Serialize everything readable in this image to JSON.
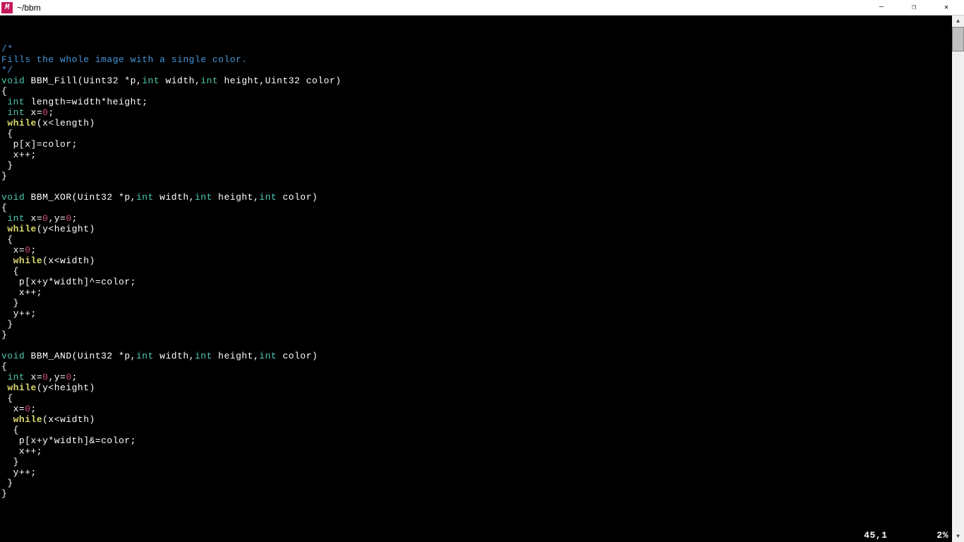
{
  "titlebar": {
    "icon_letter": "M",
    "title": "~/bbm",
    "minimize": "—",
    "maximize": "❐",
    "close": "✕"
  },
  "status": {
    "position": "45,1",
    "percent": "2%"
  },
  "code": {
    "lines": [
      {
        "t": "cmt",
        "text": "/*"
      },
      {
        "t": "cmt",
        "text": "Fills the whole image with a single color."
      },
      {
        "t": "cmt",
        "text": "*/"
      },
      {
        "t": "sig",
        "segments": [
          {
            "c": "type",
            "t": "void"
          },
          {
            "c": "def",
            "t": " BBM_Fill(Uint32 *p,"
          },
          {
            "c": "type",
            "t": "int"
          },
          {
            "c": "def",
            "t": " width,"
          },
          {
            "c": "type",
            "t": "int"
          },
          {
            "c": "def",
            "t": " height,Uint32 color)"
          }
        ]
      },
      {
        "t": "def",
        "text": "{"
      },
      {
        "t": "mix",
        "segments": [
          {
            "c": "def",
            "t": " "
          },
          {
            "c": "type",
            "t": "int"
          },
          {
            "c": "def",
            "t": " length=width*height;"
          }
        ]
      },
      {
        "t": "mix",
        "segments": [
          {
            "c": "def",
            "t": " "
          },
          {
            "c": "type",
            "t": "int"
          },
          {
            "c": "def",
            "t": " x="
          },
          {
            "c": "num",
            "t": "0"
          },
          {
            "c": "def",
            "t": ";"
          }
        ]
      },
      {
        "t": "mix",
        "segments": [
          {
            "c": "def",
            "t": " "
          },
          {
            "c": "kw",
            "t": "while"
          },
          {
            "c": "def",
            "t": "(x<length)"
          }
        ]
      },
      {
        "t": "def",
        "text": " {"
      },
      {
        "t": "def",
        "text": "  p[x]=color;"
      },
      {
        "t": "def",
        "text": "  x++;"
      },
      {
        "t": "def",
        "text": " }"
      },
      {
        "t": "def",
        "text": "}"
      },
      {
        "t": "def",
        "text": ""
      },
      {
        "t": "sig",
        "segments": [
          {
            "c": "type",
            "t": "void"
          },
          {
            "c": "def",
            "t": " BBM_XOR(Uint32 *p,"
          },
          {
            "c": "type",
            "t": "int"
          },
          {
            "c": "def",
            "t": " width,"
          },
          {
            "c": "type",
            "t": "int"
          },
          {
            "c": "def",
            "t": " height,"
          },
          {
            "c": "type",
            "t": "int"
          },
          {
            "c": "def",
            "t": " color)"
          }
        ]
      },
      {
        "t": "def",
        "text": "{"
      },
      {
        "t": "mix",
        "segments": [
          {
            "c": "def",
            "t": " "
          },
          {
            "c": "type",
            "t": "int"
          },
          {
            "c": "def",
            "t": " x="
          },
          {
            "c": "num",
            "t": "0"
          },
          {
            "c": "def",
            "t": ",y="
          },
          {
            "c": "num",
            "t": "0"
          },
          {
            "c": "def",
            "t": ";"
          }
        ]
      },
      {
        "t": "mix",
        "segments": [
          {
            "c": "def",
            "t": " "
          },
          {
            "c": "kw",
            "t": "while"
          },
          {
            "c": "def",
            "t": "(y<height)"
          }
        ]
      },
      {
        "t": "def",
        "text": " {"
      },
      {
        "t": "mix",
        "segments": [
          {
            "c": "def",
            "t": "  x="
          },
          {
            "c": "num",
            "t": "0"
          },
          {
            "c": "def",
            "t": ";"
          }
        ]
      },
      {
        "t": "mix",
        "segments": [
          {
            "c": "def",
            "t": "  "
          },
          {
            "c": "kw",
            "t": "while"
          },
          {
            "c": "def",
            "t": "(x<width)"
          }
        ]
      },
      {
        "t": "def",
        "text": "  {"
      },
      {
        "t": "def",
        "text": "   p[x+y*width]^=color;"
      },
      {
        "t": "def",
        "text": "   x++;"
      },
      {
        "t": "def",
        "text": "  }"
      },
      {
        "t": "def",
        "text": "  y++;"
      },
      {
        "t": "def",
        "text": " }"
      },
      {
        "t": "def",
        "text": "}"
      },
      {
        "t": "def",
        "text": ""
      },
      {
        "t": "sig",
        "segments": [
          {
            "c": "type",
            "t": "void"
          },
          {
            "c": "def",
            "t": " BBM_AND(Uint32 *p,"
          },
          {
            "c": "type",
            "t": "int"
          },
          {
            "c": "def",
            "t": " width,"
          },
          {
            "c": "type",
            "t": "int"
          },
          {
            "c": "def",
            "t": " height,"
          },
          {
            "c": "type",
            "t": "int"
          },
          {
            "c": "def",
            "t": " color)"
          }
        ]
      },
      {
        "t": "def",
        "text": "{"
      },
      {
        "t": "mix",
        "segments": [
          {
            "c": "def",
            "t": " "
          },
          {
            "c": "type",
            "t": "int"
          },
          {
            "c": "def",
            "t": " x="
          },
          {
            "c": "num",
            "t": "0"
          },
          {
            "c": "def",
            "t": ",y="
          },
          {
            "c": "num",
            "t": "0"
          },
          {
            "c": "def",
            "t": ";"
          }
        ]
      },
      {
        "t": "mix",
        "segments": [
          {
            "c": "def",
            "t": " "
          },
          {
            "c": "kw",
            "t": "while"
          },
          {
            "c": "def",
            "t": "(y<height)"
          }
        ]
      },
      {
        "t": "def",
        "text": " {"
      },
      {
        "t": "mix",
        "segments": [
          {
            "c": "def",
            "t": "  x="
          },
          {
            "c": "num",
            "t": "0"
          },
          {
            "c": "def",
            "t": ";"
          }
        ]
      },
      {
        "t": "mix",
        "segments": [
          {
            "c": "def",
            "t": "  "
          },
          {
            "c": "kw",
            "t": "while"
          },
          {
            "c": "def",
            "t": "(x<width)"
          }
        ]
      },
      {
        "t": "def",
        "text": "  {"
      },
      {
        "t": "def",
        "text": "   p[x+y*width]&=color;"
      },
      {
        "t": "def",
        "text": "   x++;"
      },
      {
        "t": "def",
        "text": "  }"
      },
      {
        "t": "def",
        "text": "  y++;"
      },
      {
        "t": "def",
        "text": " }"
      },
      {
        "t": "def",
        "text": "}"
      }
    ]
  }
}
